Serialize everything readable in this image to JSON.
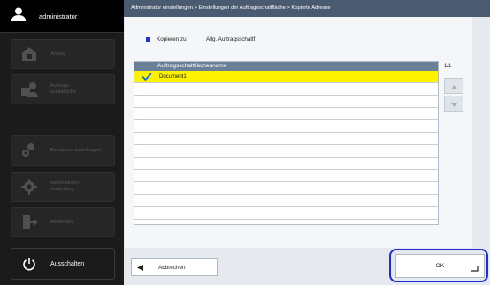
{
  "sidebar": {
    "user_name": "administrator",
    "items": [
      {
        "label": "Anfang",
        "icon": "home-icon"
      },
      {
        "label": "Auftrags-\nschaltfläche",
        "icon": "task-button-icon"
      },
      {
        "label": "Benutzerei.instellungen",
        "icon": "user-settings-icon"
      },
      {
        "label": "Administrator\neinstellung",
        "icon": "admin-settings-icon"
      },
      {
        "label": "Abmelden",
        "icon": "logout-icon"
      }
    ],
    "power_label": "Ausschalten"
  },
  "breadcrumb": "Administrator einstellungen > Einstellungen der Auftragsschaltfläche > Kopierte Adresse",
  "copy_to": {
    "label": "Kopieren zu",
    "value": "Allg. Auftragsschaltf."
  },
  "list": {
    "header": "Auftragsschaltflächenname",
    "rows": [
      {
        "name": "Document1",
        "selected": true
      }
    ],
    "page": "1/1"
  },
  "buttons": {
    "cancel": "Abbrechen",
    "ok": "OK"
  },
  "colors": {
    "selected_row": "#fff200",
    "focus_ring": "#1d2bd8",
    "header_bar": "#4a5a70",
    "list_header": "#6a8096"
  }
}
